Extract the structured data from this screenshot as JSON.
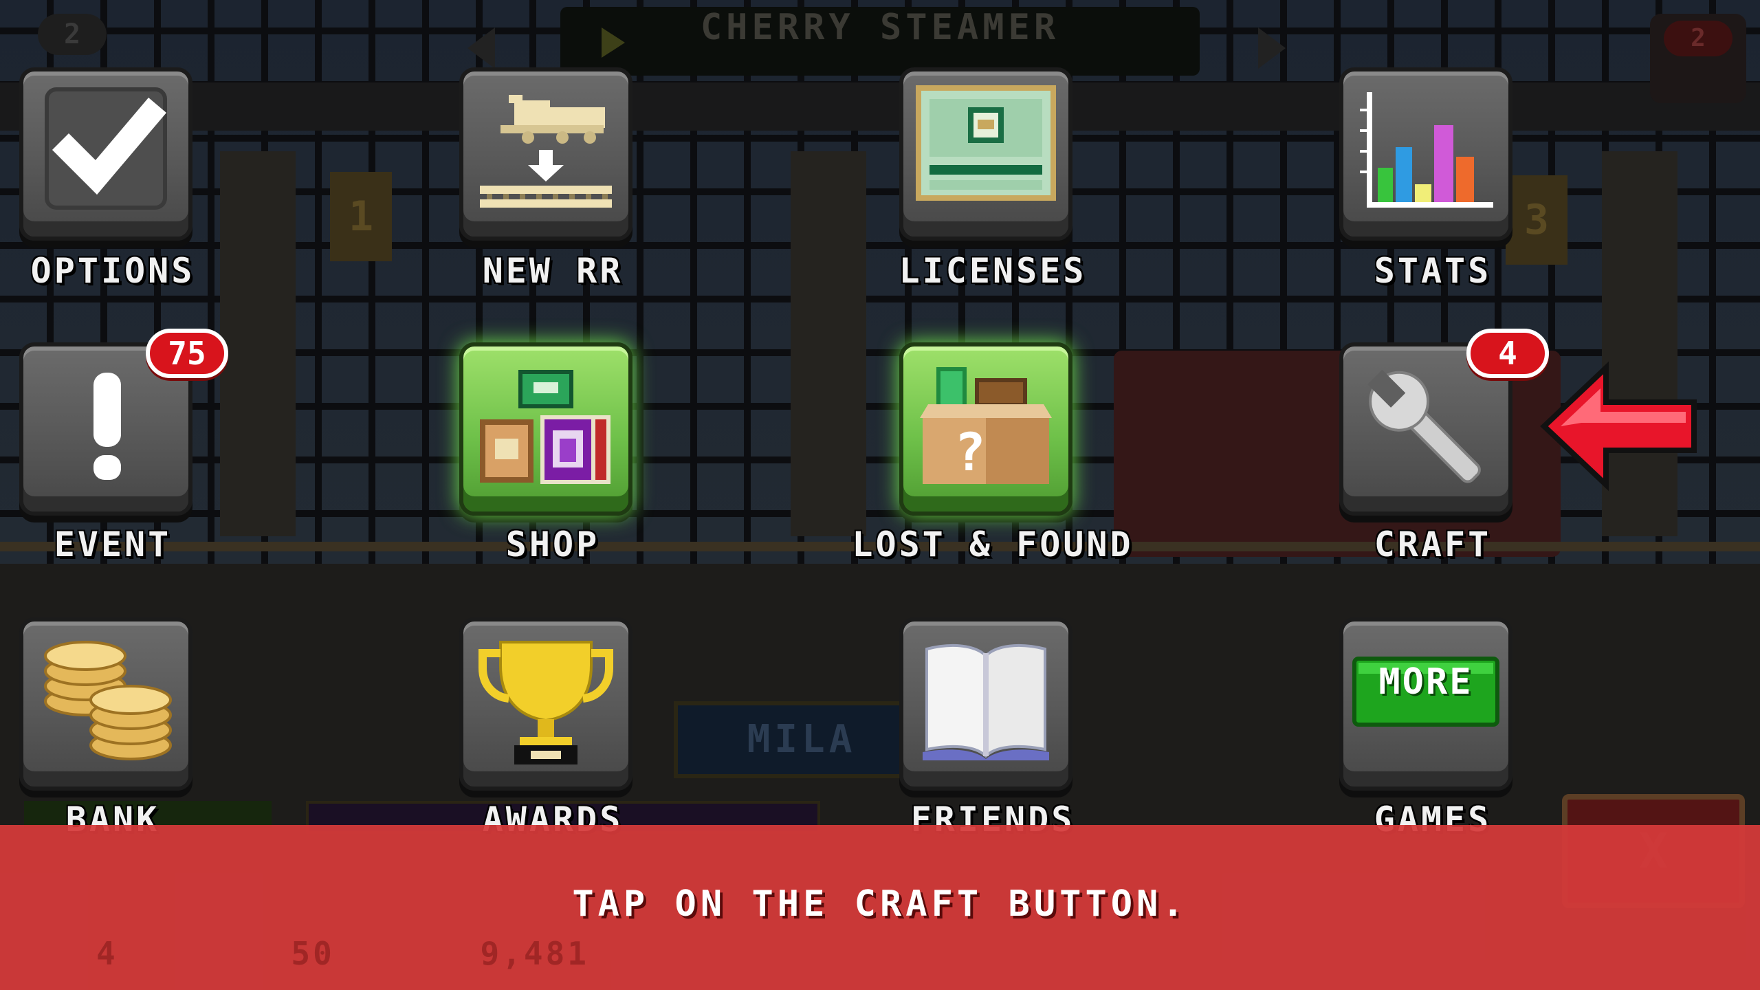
{
  "header": {
    "train_name": "CHERRY STEAMER",
    "left_counter": "2",
    "right_counter": "2"
  },
  "background": {
    "platform_numbers": [
      "1",
      "3"
    ],
    "station_sign": "MILA",
    "close_glyph": "X"
  },
  "menu": {
    "options": "OPTIONS",
    "new_rr": "NEW RR",
    "licenses": "LICENSES",
    "stats": "STATS",
    "event": "EVENT",
    "event_badge": "75",
    "shop": "SHOP",
    "lost_found": "LOST & FOUND",
    "lost_found_question": "?",
    "craft": "CRAFT",
    "craft_badge": "4",
    "bank": "BANK",
    "awards": "AWARDS",
    "friends": "FRIENDS",
    "games": "GAMES",
    "more_label": "MORE"
  },
  "tutorial": {
    "message": "TAP ON THE CRAFT BUTTON."
  },
  "status_bar_ghost": [
    "4",
    "50",
    "9,481"
  ],
  "colors": {
    "banner": "#d63a3a",
    "badge": "#d8141c",
    "pointer_arrow": "#e8152a",
    "highlight_green": "#6fc14a"
  },
  "icons": {
    "options": "checkmark-icon",
    "new_rr": "train-download-icon",
    "licenses": "license-card-icon",
    "stats": "bar-chart-icon",
    "event": "exclamation-icon",
    "shop": "shop-items-icon",
    "lost_found": "mystery-box-icon",
    "craft": "wrench-icon",
    "bank": "coins-icon",
    "awards": "trophy-icon",
    "friends": "open-book-icon",
    "games": "more-games-icon",
    "pointer": "red-arrow-left-icon"
  }
}
